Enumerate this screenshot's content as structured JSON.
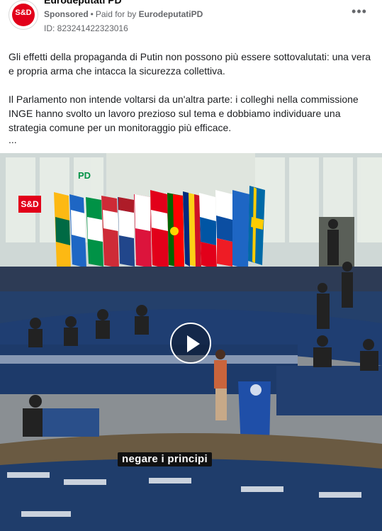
{
  "post": {
    "page_name": "Eurodeputati PD",
    "sponsored": "Sponsored",
    "dot": "•",
    "paid_for_by_prefix": "Paid for by",
    "paid_for_by": "EurodeputatiPD",
    "ad_id": "ID: 823241422323016",
    "more_icon": "more-horizontal-icon",
    "more_text": "•••",
    "avatar_text": "S&D",
    "paragraph_1": "Gli effetti della propaganda di Putin non possono più essere sottovalutati: una vera e propria arma che intacca la sicurezza collettiva.",
    "paragraph_2": "Il Parlamento non intende voltarsi da un'altra parte: i colleghi nella commissione INGE hanno svolto un lavoro prezioso sul tema e dobbiamo individuare una strategia comune per un monitoraggio più efficace.",
    "ellipsis": "..."
  },
  "video": {
    "caption": "negare i principi",
    "logo_sd": "S&D",
    "logo_pd": "PD",
    "play_icon": "play-icon"
  },
  "colors": {
    "accent_red": "#e2001a",
    "meta_gray": "#65676b",
    "text": "#1c1e21"
  }
}
